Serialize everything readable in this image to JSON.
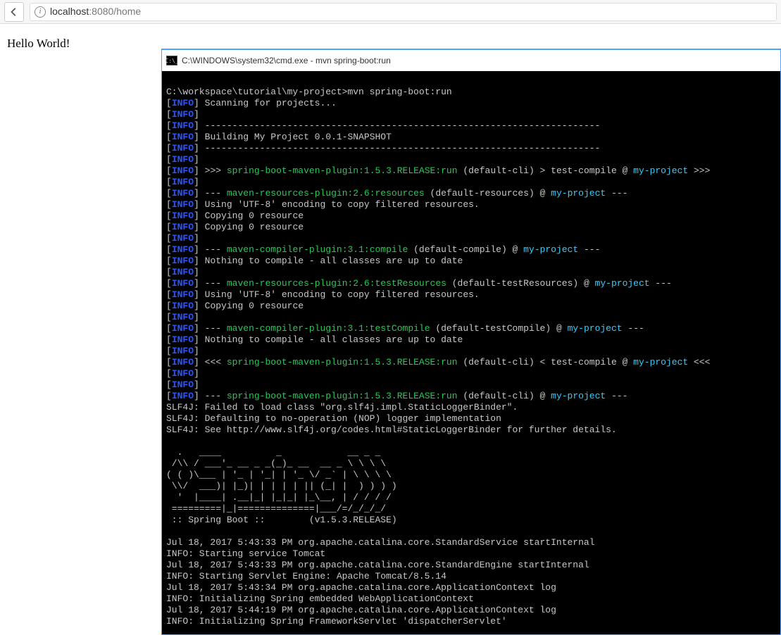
{
  "browser": {
    "url_host": "localhost",
    "url_port_path": ":8080/home",
    "page_text": "Hello World!"
  },
  "cmd": {
    "title_prefix": "C:\\WINDOWS\\system32\\cmd.exe - mvn  spring-boot:run",
    "icon_text": "C:\\_",
    "lines": [
      {
        "t": "raw",
        "text": ""
      },
      {
        "t": "raw",
        "text": "C:\\workspace\\tutorial\\my-project>mvn spring-boot:run"
      },
      {
        "t": "info",
        "text": "Scanning for projects..."
      },
      {
        "t": "info",
        "text": ""
      },
      {
        "t": "info",
        "text": "------------------------------------------------------------------------"
      },
      {
        "t": "info",
        "text": "Building My Project 0.0.1-SNAPSHOT"
      },
      {
        "t": "info",
        "text": "------------------------------------------------------------------------"
      },
      {
        "t": "info",
        "text": ""
      },
      {
        "t": "info_goal",
        "pre": ">>> ",
        "plugin": "spring-boot-maven-plugin:1.5.3.RELEASE:run",
        "mid": " (default-cli) > test-compile @ ",
        "proj": "my-project",
        "post": " >>>"
      },
      {
        "t": "info",
        "text": ""
      },
      {
        "t": "info_goal",
        "pre": "--- ",
        "plugin": "maven-resources-plugin:2.6:resources",
        "mid": " (default-resources) @ ",
        "proj": "my-project",
        "post": " ---"
      },
      {
        "t": "info",
        "text": "Using 'UTF-8' encoding to copy filtered resources."
      },
      {
        "t": "info",
        "text": "Copying 0 resource"
      },
      {
        "t": "info",
        "text": "Copying 0 resource"
      },
      {
        "t": "info",
        "text": ""
      },
      {
        "t": "info_goal",
        "pre": "--- ",
        "plugin": "maven-compiler-plugin:3.1:compile",
        "mid": " (default-compile) @ ",
        "proj": "my-project",
        "post": " ---"
      },
      {
        "t": "info",
        "text": "Nothing to compile - all classes are up to date"
      },
      {
        "t": "info",
        "text": ""
      },
      {
        "t": "info_goal",
        "pre": "--- ",
        "plugin": "maven-resources-plugin:2.6:testResources",
        "mid": " (default-testResources) @ ",
        "proj": "my-project",
        "post": " ---"
      },
      {
        "t": "info",
        "text": "Using 'UTF-8' encoding to copy filtered resources."
      },
      {
        "t": "info",
        "text": "Copying 0 resource"
      },
      {
        "t": "info",
        "text": ""
      },
      {
        "t": "info_goal",
        "pre": "--- ",
        "plugin": "maven-compiler-plugin:3.1:testCompile",
        "mid": " (default-testCompile) @ ",
        "proj": "my-project",
        "post": " ---"
      },
      {
        "t": "info",
        "text": "Nothing to compile - all classes are up to date"
      },
      {
        "t": "info",
        "text": ""
      },
      {
        "t": "info_goal",
        "pre": "<<< ",
        "plugin": "spring-boot-maven-plugin:1.5.3.RELEASE:run",
        "mid": " (default-cli) < test-compile @ ",
        "proj": "my-project",
        "post": " <<<"
      },
      {
        "t": "info",
        "text": ""
      },
      {
        "t": "info",
        "text": ""
      },
      {
        "t": "info_goal",
        "pre": "--- ",
        "plugin": "spring-boot-maven-plugin:1.5.3.RELEASE:run",
        "mid": " (default-cli) @ ",
        "proj": "my-project",
        "post": " ---"
      },
      {
        "t": "raw",
        "text": "SLF4J: Failed to load class \"org.slf4j.impl.StaticLoggerBinder\"."
      },
      {
        "t": "raw",
        "text": "SLF4J: Defaulting to no-operation (NOP) logger implementation"
      },
      {
        "t": "raw",
        "text": "SLF4J: See http://www.slf4j.org/codes.html#StaticLoggerBinder for further details."
      },
      {
        "t": "raw",
        "text": ""
      },
      {
        "t": "raw",
        "text": "  .   ____          _            __ _ _"
      },
      {
        "t": "raw",
        "text": " /\\\\ / ___'_ __ _ _(_)_ __  __ _ \\ \\ \\ \\"
      },
      {
        "t": "raw",
        "text": "( ( )\\___ | '_ | '_| | '_ \\/ _` | \\ \\ \\ \\"
      },
      {
        "t": "raw",
        "text": " \\\\/  ___)| |_)| | | | | || (_| |  ) ) ) )"
      },
      {
        "t": "raw",
        "text": "  '  |____| .__|_| |_|_| |_\\__, | / / / /"
      },
      {
        "t": "raw",
        "text": " =========|_|==============|___/=/_/_/_/"
      },
      {
        "t": "raw",
        "text": " :: Spring Boot ::        (v1.5.3.RELEASE)"
      },
      {
        "t": "raw",
        "text": ""
      },
      {
        "t": "raw",
        "text": "Jul 18, 2017 5:43:33 PM org.apache.catalina.core.StandardService startInternal"
      },
      {
        "t": "raw",
        "text": "INFO: Starting service Tomcat"
      },
      {
        "t": "raw",
        "text": "Jul 18, 2017 5:43:33 PM org.apache.catalina.core.StandardEngine startInternal"
      },
      {
        "t": "raw",
        "text": "INFO: Starting Servlet Engine: Apache Tomcat/8.5.14"
      },
      {
        "t": "raw",
        "text": "Jul 18, 2017 5:43:34 PM org.apache.catalina.core.ApplicationContext log"
      },
      {
        "t": "raw",
        "text": "INFO: Initializing Spring embedded WebApplicationContext"
      },
      {
        "t": "raw",
        "text": "Jul 18, 2017 5:44:19 PM org.apache.catalina.core.ApplicationContext log"
      },
      {
        "t": "raw",
        "text": "INFO: Initializing Spring FrameworkServlet 'dispatcherServlet'"
      }
    ]
  }
}
